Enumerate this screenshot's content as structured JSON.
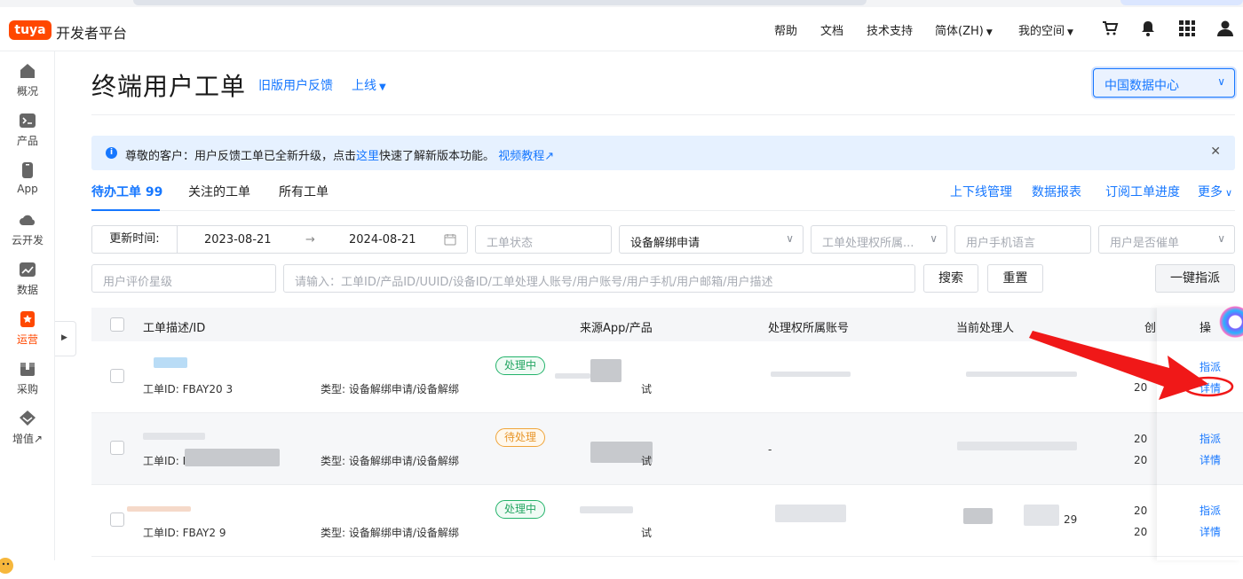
{
  "brand": {
    "logo_text": "tuya",
    "name": "开发者平台",
    "accent": "#ff4800"
  },
  "topnav": {
    "items": [
      "帮助",
      "文档",
      "技术支持",
      "简体(ZH)",
      "我的空间"
    ],
    "icons": [
      "cart-icon",
      "bell-icon",
      "apps-grid-icon",
      "user-icon"
    ]
  },
  "sidebar": {
    "items": [
      {
        "label": "概况",
        "icon": "home-icon"
      },
      {
        "label": "产品",
        "icon": "terminal-icon"
      },
      {
        "label": "App",
        "icon": "phone-icon"
      },
      {
        "label": "云开发",
        "icon": "cloud-icon"
      },
      {
        "label": "数据",
        "icon": "chart-icon"
      },
      {
        "label": "运营",
        "icon": "star-badge-icon",
        "active": true
      },
      {
        "label": "采购",
        "icon": "box-icon"
      },
      {
        "label": "增值↗",
        "icon": "diamond-icon"
      }
    ]
  },
  "header": {
    "title": "终端用户工单",
    "links": [
      "旧版用户反馈",
      "上线"
    ],
    "region": "中国数据中心"
  },
  "notice": {
    "prefix": "尊敬的客户：用户反馈工单已全新升级，点击",
    "link": "这里",
    "middle": "快速了解新版本功能。",
    "video": "视频教程↗"
  },
  "tabs": [
    "待办工单 99",
    "关注的工单",
    "所有工单"
  ],
  "right_links": [
    "上下线管理",
    "数据报表",
    "订阅工单进度",
    "更多"
  ],
  "filters": {
    "date_label": "更新时间:",
    "start": "2023-08-21",
    "arrow": "→",
    "end": "2024-08-21",
    "status_ph": "工单状态",
    "type_val": "设备解绑申请",
    "owner_ph": "工单处理权所属...",
    "lang_ph": "用户手机语言",
    "urge_ph": "用户是否催单",
    "rating_ph": "用户评价星级",
    "search_ph": "请输入：工单ID/产品ID/UUID/设备ID/工单处理人账号/用户账号/用户手机/用户邮箱/用户描述",
    "search_btn": "搜索",
    "reset_btn": "重置",
    "assign_all_btn": "一键指派"
  },
  "table": {
    "headers": [
      "工单描述/ID",
      "来源App/产品",
      "处理权所属账号",
      "当前处理人",
      "创",
      "操"
    ],
    "rows": [
      {
        "id": "工单ID: FBAY20    3",
        "type": "类型: 设备解绑申请/设备解绑",
        "status": "处理中",
        "status_kind": "green",
        "src": "试",
        "handler": "",
        "date": "20",
        "assign": "指派",
        "detail": "详情"
      },
      {
        "id": "工单ID: F",
        "type": "类型: 设备解绑申请/设备解绑",
        "status": "待处理",
        "status_kind": "orange",
        "src": "试",
        "handler": "-",
        "date1": "20",
        "date2": "20",
        "assign": "指派",
        "detail": "详情"
      },
      {
        "id": "工单ID: FBAY2    9",
        "type": "类型: 设备解绑申请/设备解绑",
        "status": "处理中",
        "status_kind": "green",
        "src": "试",
        "handler": "29",
        "date1": "20",
        "date2": "20",
        "assign": "指派",
        "detail": "详情"
      }
    ]
  }
}
